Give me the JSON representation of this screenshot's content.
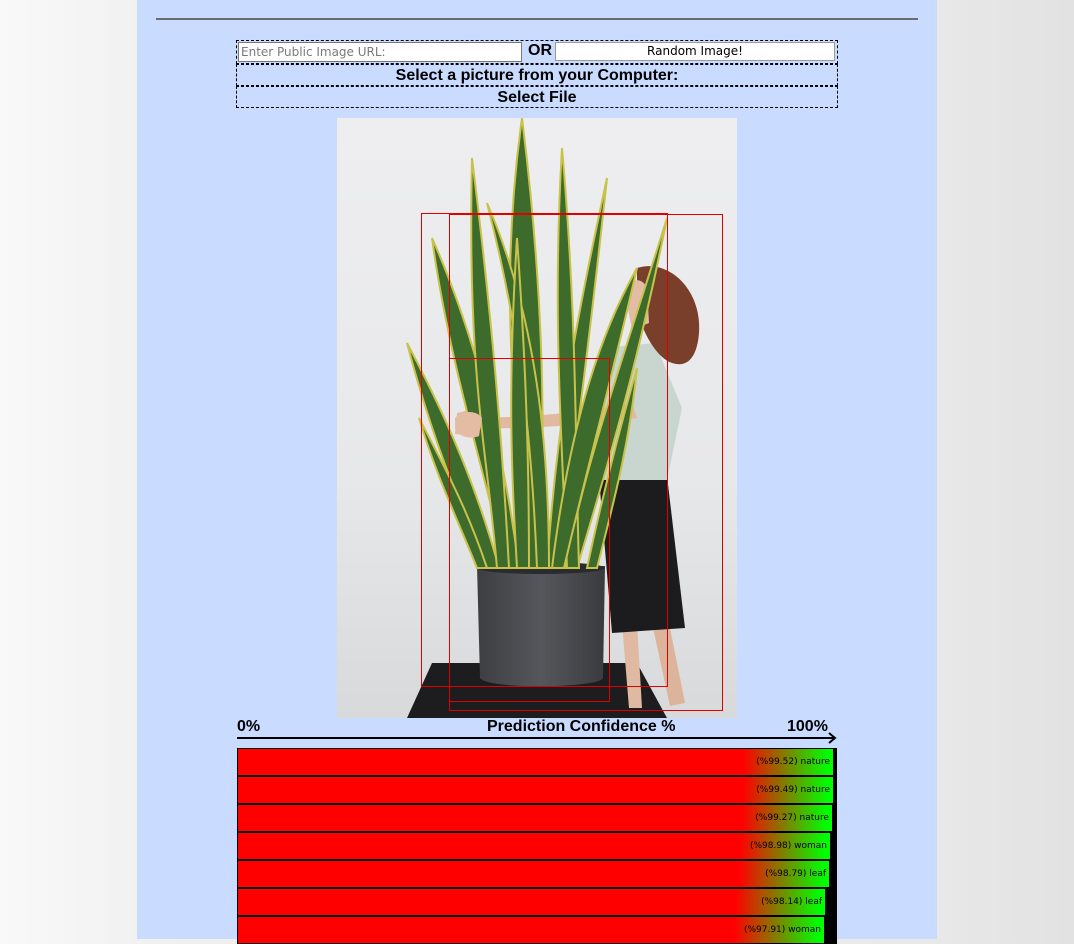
{
  "form": {
    "url_placeholder": "Enter Public Image URL:",
    "or_label": "OR",
    "random_button_label": "Random Image!",
    "select_prompt": "Select a picture from your Computer:",
    "select_file_label": "Select File"
  },
  "photo": {
    "description_icon": "plant-woman-photo"
  },
  "confidence_axis": {
    "min_label": "0%",
    "title": "Prediction Confidence %",
    "max_label": "100%"
  },
  "predictions": [
    {
      "label": "(%99.52) nature",
      "confidence": 99.52
    },
    {
      "label": "(%99.49) nature",
      "confidence": 99.49
    },
    {
      "label": "(%99.27) nature",
      "confidence": 99.27
    },
    {
      "label": "(%98.98) woman",
      "confidence": 98.98
    },
    {
      "label": "(%98.79) leaf",
      "confidence": 98.79
    },
    {
      "label": "(%98.14) leaf",
      "confidence": 98.14
    },
    {
      "label": "(%97.91) woman",
      "confidence": 97.91
    }
  ],
  "colors": {
    "panel_background": "#c9dcff",
    "bar_low": "#ff0000",
    "bar_high": "#00ff00",
    "detection_box": "#e00000"
  }
}
